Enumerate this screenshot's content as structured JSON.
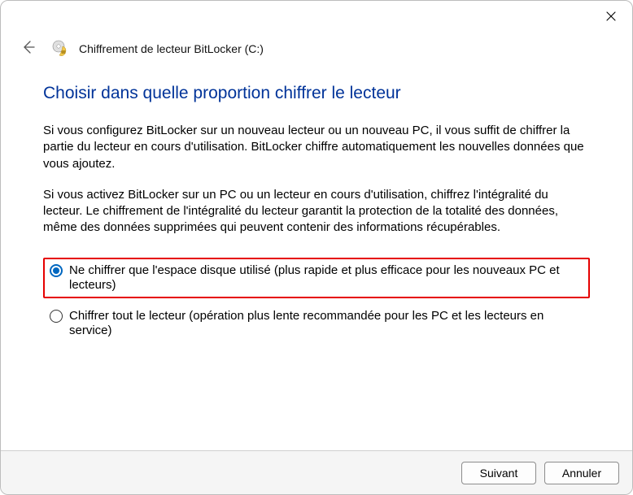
{
  "header": {
    "breadcrumb": "Chiffrement de lecteur BitLocker (C:)"
  },
  "main": {
    "title": "Choisir dans quelle proportion chiffrer le lecteur",
    "para1": "Si vous configurez BitLocker sur un nouveau lecteur ou un nouveau PC, il vous suffit de chiffrer la partie du lecteur en cours d'utilisation. BitLocker chiffre automatiquement les nouvelles données que vous ajoutez.",
    "para2": "Si vous activez BitLocker sur un PC ou un lecteur en cours d'utilisation, chiffrez l'intégralité du lecteur. Le chiffrement de l'intégralité du lecteur garantit la protection de la totalité des données, même des données supprimées qui peuvent contenir des informations récupérables.",
    "options": [
      {
        "label": "Ne chiffrer que l'espace disque utilisé (plus rapide et plus efficace pour les nouveaux PC et lecteurs)",
        "selected": true,
        "highlighted": true
      },
      {
        "label": "Chiffrer tout le lecteur (opération plus lente recommandée pour les PC et les lecteurs en service)",
        "selected": false,
        "highlighted": false
      }
    ]
  },
  "footer": {
    "next": "Suivant",
    "cancel": "Annuler"
  }
}
